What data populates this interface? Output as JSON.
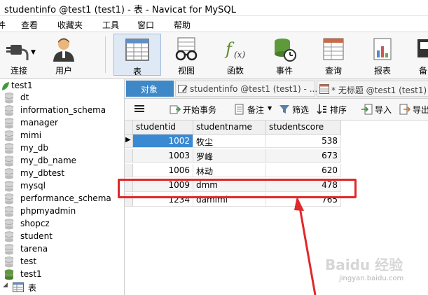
{
  "window": {
    "title": "studentinfo @test1 (test1) - 表 - Navicat for MySQL"
  },
  "menu": {
    "items": [
      "件",
      "查看",
      "收藏夹",
      "工具",
      "窗口",
      "帮助"
    ]
  },
  "toolbar": {
    "connect": "连接",
    "user": "用户",
    "table": "表",
    "view": "视图",
    "function": "函数",
    "event": "事件",
    "query": "查询",
    "report": "报表",
    "more": "备"
  },
  "tree": {
    "root": "test1",
    "items": [
      "dt",
      "information_schema",
      "manager",
      "mimi",
      "my_db",
      "my_db_name",
      "my_dbtest",
      "mysql",
      "performance_schema",
      "phpmyadmin",
      "shopcz",
      "student",
      "tarena",
      "test",
      "test1"
    ],
    "sub": "表"
  },
  "tabs": {
    "objects": "对象",
    "tab2": "studentinfo @test1 (test1) - ...",
    "tab3": "* 无标题 @test1 (test1) - ..."
  },
  "actions": {
    "menu_icon": "hamburger-icon",
    "begin": "开始事务",
    "note": "备注",
    "filter": "筛选",
    "sort": "排序",
    "import": "导入",
    "export": "导出"
  },
  "table": {
    "columns": [
      "studentid",
      "studentname",
      "studentscore"
    ],
    "rows": [
      [
        "1002",
        "牧尘",
        "538"
      ],
      [
        "1003",
        "罗峰",
        "673"
      ],
      [
        "1006",
        "林动",
        "620"
      ],
      [
        "1009",
        "dmm",
        "478"
      ],
      [
        "1234",
        "damimi",
        "765"
      ]
    ]
  },
  "colors": {
    "accent": "#3f88c8",
    "highlight": "#e0282a",
    "selected": "#3a89d2"
  },
  "watermark": {
    "brand": "Baidu 经验",
    "site": "jingyan.baidu.com"
  }
}
